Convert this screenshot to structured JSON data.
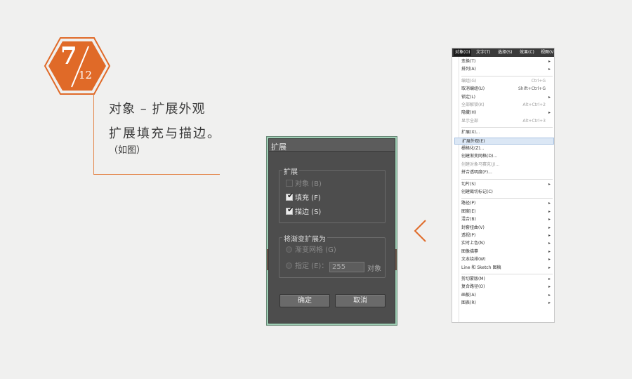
{
  "step": {
    "current": "7",
    "total": "12",
    "color": "#e06a28"
  },
  "text": {
    "line1": "对象 – 扩展外观",
    "line2": "扩展填充与描边。",
    "line3": "（如图）"
  },
  "dialog": {
    "title": "扩展",
    "group1": {
      "label": "扩展",
      "options": [
        {
          "label": "对象 (B)",
          "checked": false,
          "enabled": false
        },
        {
          "label": "填充 (F)",
          "checked": true,
          "enabled": true
        },
        {
          "label": "描边 (S)",
          "checked": true,
          "enabled": true
        }
      ]
    },
    "group2": {
      "label": "将渐变扩展为",
      "radio1": "渐变网格 (G)",
      "radio2": "指定 (E)：",
      "specify_value": "255",
      "specify_unit": "对象"
    },
    "ok_button": "确定",
    "cancel_button": "取消"
  },
  "arrow_icon": "chevron-left-icon",
  "menu": {
    "menubar": [
      "对象(O)",
      "文字(T)",
      "选择(S)",
      "效果(C)",
      "视图(V)"
    ],
    "active_menubar": "对象(O)",
    "items": [
      {
        "label": "变换(T)",
        "submenu": true
      },
      {
        "label": "排列(A)",
        "submenu": true
      },
      {
        "sep": true
      },
      {
        "label": "编组(G)",
        "shortcut": "Ctrl+G",
        "dim": true
      },
      {
        "label": "取消编组(U)",
        "shortcut": "Shift+Ctrl+G"
      },
      {
        "label": "锁定(L)",
        "submenu": true
      },
      {
        "label": "全部解锁(K)",
        "shortcut": "Alt+Ctrl+2",
        "dim": true
      },
      {
        "label": "隐藏(H)",
        "submenu": true
      },
      {
        "label": "显示全部",
        "shortcut": "Alt+Ctrl+3",
        "dim": true
      },
      {
        "sep": true
      },
      {
        "label": "扩展(X)..."
      },
      {
        "label": "扩展外观(E)",
        "highlight": true
      },
      {
        "label": "栅格化(Z)..."
      },
      {
        "label": "创建渐变网格(D)..."
      },
      {
        "label": "创建对象马赛克(J)...",
        "dim": true
      },
      {
        "label": "拼合透明度(F)..."
      },
      {
        "sep": true
      },
      {
        "label": "切片(S)",
        "submenu": true
      },
      {
        "label": "创建裁切标记(C)"
      },
      {
        "sep": true
      },
      {
        "label": "路径(P)",
        "submenu": true
      },
      {
        "label": "图案(E)",
        "submenu": true
      },
      {
        "label": "混合(B)",
        "submenu": true
      },
      {
        "label": "封套扭曲(V)",
        "submenu": true
      },
      {
        "label": "透视(P)",
        "submenu": true
      },
      {
        "label": "实时上色(N)",
        "submenu": true
      },
      {
        "label": "图像描摹",
        "submenu": true
      },
      {
        "label": "文本绕排(W)",
        "submenu": true
      },
      {
        "label": "Line 和 Sketch 图稿",
        "submenu": true
      },
      {
        "sep": true
      },
      {
        "label": "剪切蒙版(M)",
        "submenu": true
      },
      {
        "label": "复合路径(O)",
        "submenu": true
      },
      {
        "label": "画板(A)",
        "submenu": true
      },
      {
        "label": "图表(R)",
        "submenu": true
      }
    ]
  }
}
